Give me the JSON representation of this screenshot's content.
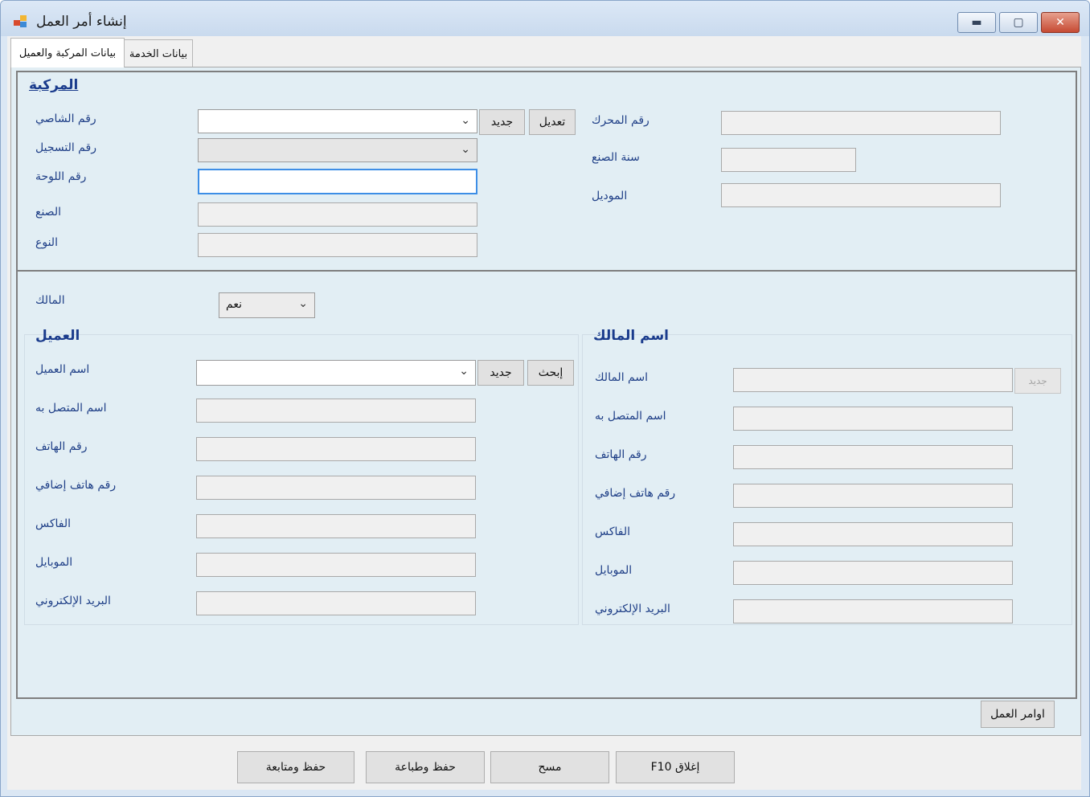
{
  "window": {
    "title": "إنشاء أمر العمل",
    "icon": "app-window-icon",
    "controls": [
      "minimize",
      "maximize",
      "close"
    ]
  },
  "tabs": [
    {
      "label": "بيانات المركبة والعميل",
      "active": true
    },
    {
      "label": "بيانات الخدمة",
      "active": false
    }
  ],
  "vehicle": {
    "section_title": "المركبة",
    "chassis_label": "رقم الشاصي",
    "registration_label": "رقم التسجيل",
    "plate_label": "رقم اللوحة",
    "make_label": "الصنع",
    "type_label": "النوع",
    "new_button": "جديد",
    "edit_button": "تعديل",
    "engine_label": "رقم المحرك",
    "year_label": "سنة الصنع",
    "model_label": "الموديل"
  },
  "owner_select": {
    "label": "المالك",
    "value": "نعم"
  },
  "customer": {
    "section_title": "العميل",
    "name_label": "اسم العميل",
    "new_button": "جديد",
    "search_button": "إبحث",
    "contact_label": "اسم المتصل به",
    "phone_label": "رقم الهاتف",
    "extra_phone_label": "رقم هاتف إضافي",
    "fax_label": "الفاكس",
    "mobile_label": "الموبايل",
    "email_label": "البريد الإلكتروني"
  },
  "owner": {
    "section_title": "اسم المالك",
    "name_label": "اسم المالك",
    "new_button": "جديد",
    "contact_label": "اسم المتصل به",
    "phone_label": "رقم الهاتف",
    "extra_phone_label": "رقم هاتف إضافي",
    "fax_label": "الفاكس",
    "mobile_label": "الموبايل",
    "email_label": "البريد الإلكتروني"
  },
  "work_orders_button": "اوامر العمل",
  "footer": {
    "save_continue": "حفظ ومتابعة",
    "save_print": "حفظ وطباعة",
    "clear": "مسح",
    "close": "F10 إغلاق"
  }
}
